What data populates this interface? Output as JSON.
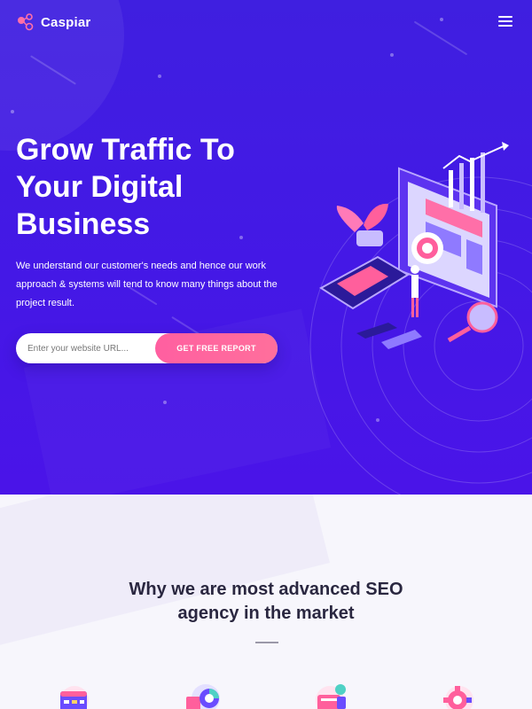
{
  "brand": {
    "name": "Caspiar"
  },
  "nav": {
    "menu_icon": "hamburger-menu-icon"
  },
  "hero": {
    "title": "Grow Traffic To\nYour Digital\nBusiness",
    "subtitle": "We understand our customer's needs and hence our work approach & systems will tend to know many things about the project result.",
    "form": {
      "placeholder": "Enter your website URL...",
      "button_label": "GET FREE REPORT"
    }
  },
  "features_section": {
    "title": "Why we are most advanced SEO\nagency in the market",
    "icons": [
      "browser-grid-icon",
      "analytics-chart-icon",
      "seo-device-icon",
      "gear-settings-icon"
    ]
  },
  "colors": {
    "hero_bg": "#4418e6",
    "accent_pink": "#ff5fa0",
    "heading_dark": "#2a2740"
  }
}
